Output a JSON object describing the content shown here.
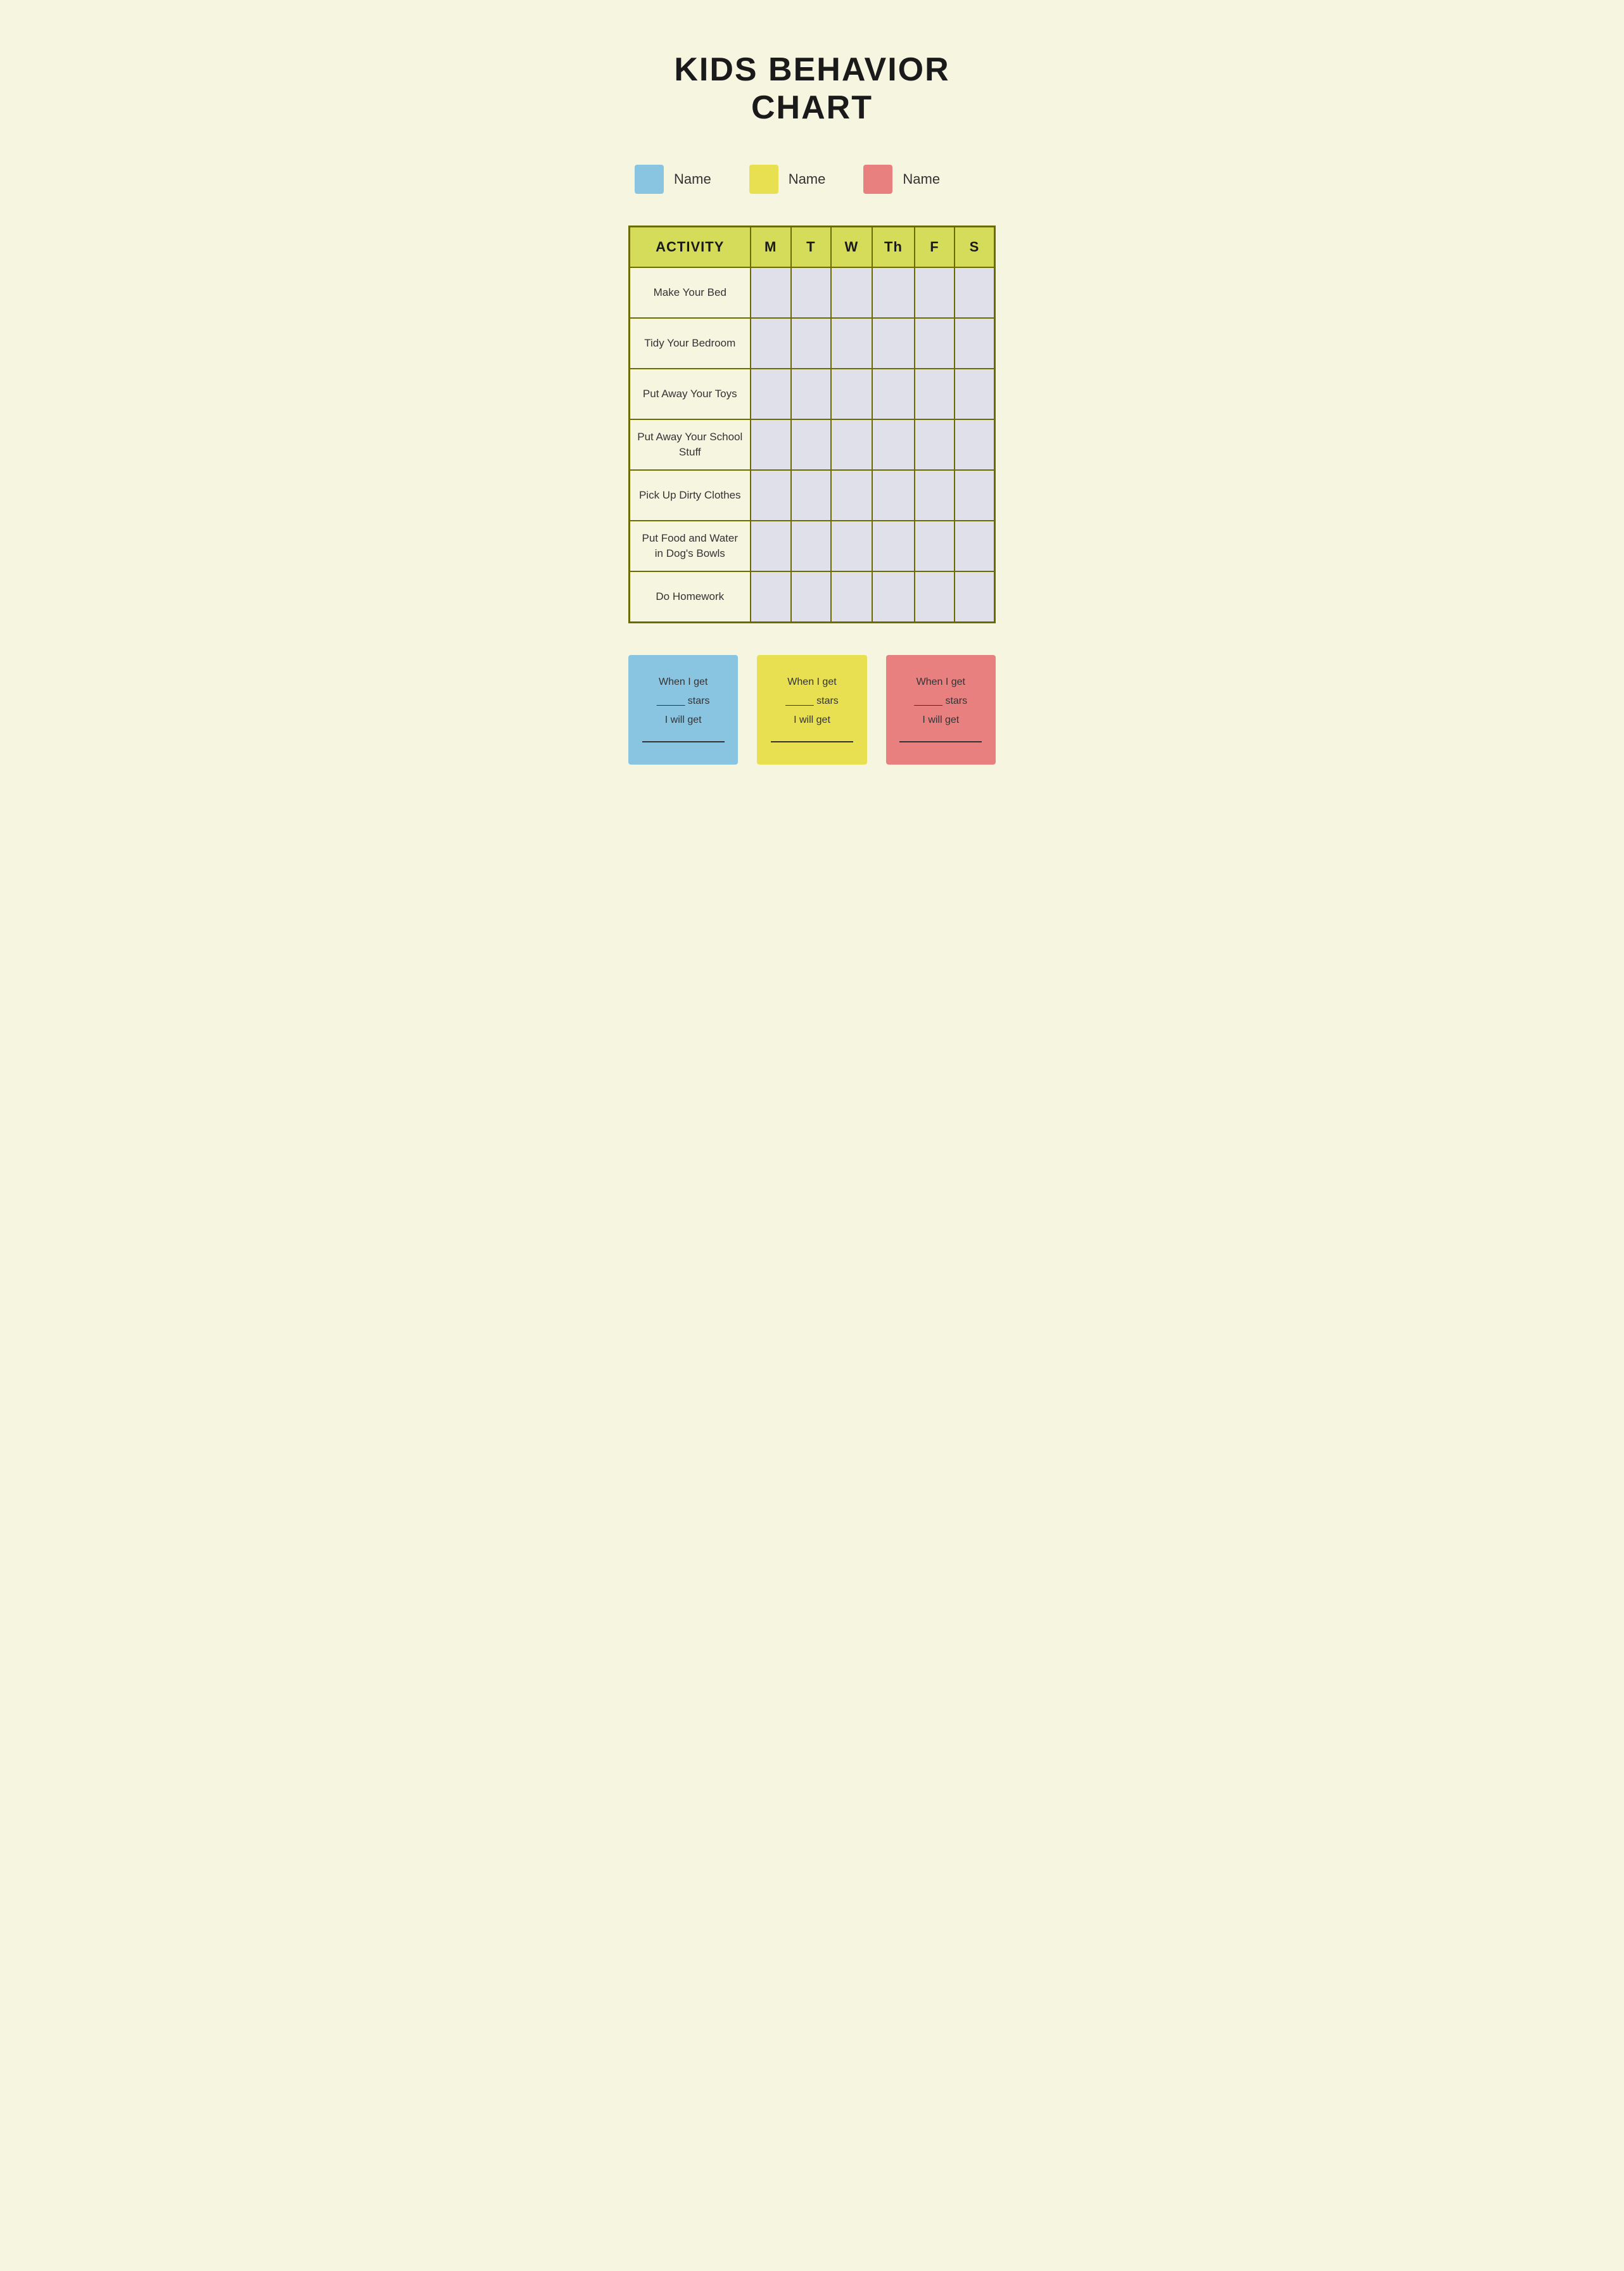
{
  "page": {
    "title": "KIDS BEHAVIOR CHART",
    "background_color": "#f5f5e0"
  },
  "legend": {
    "items": [
      {
        "id": "blue",
        "color": "#89c4e1",
        "label": "Name"
      },
      {
        "id": "yellow",
        "color": "#e8e050",
        "label": "Name"
      },
      {
        "id": "pink",
        "color": "#e88080",
        "label": "Name"
      }
    ]
  },
  "table": {
    "header": {
      "activity": "ACTIVITY",
      "days": [
        "M",
        "T",
        "W",
        "Th",
        "F",
        "S"
      ]
    },
    "rows": [
      {
        "activity": "Make Your Bed"
      },
      {
        "activity": "Tidy Your Bedroom"
      },
      {
        "activity": "Put Away Your Toys"
      },
      {
        "activity": "Put Away Your School Stuff"
      },
      {
        "activity": "Pick Up Dirty Clothes"
      },
      {
        "activity": "Put Food and Water in Dog's Bowls"
      },
      {
        "activity": "Do Homework"
      }
    ]
  },
  "rewards": [
    {
      "id": "blue",
      "background": "#89c4e1",
      "line1": "When I get",
      "line2": "_____ stars",
      "line3": "I will get",
      "line4": "_______________"
    },
    {
      "id": "yellow",
      "background": "#e8e050",
      "line1": "When I get",
      "line2": "_____ stars",
      "line3": "I will get",
      "line4": "_______________"
    },
    {
      "id": "pink",
      "background": "#e88080",
      "line1": "When I get",
      "line2": "_____ stars",
      "line3": "I will get",
      "line4": "_______________"
    }
  ]
}
